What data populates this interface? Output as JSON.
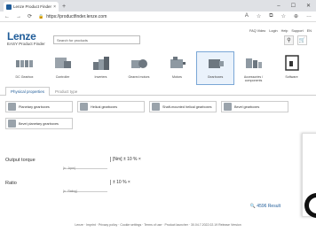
{
  "browser": {
    "tab_title": "Lenze Product Finder",
    "new_tab": "+",
    "window_controls": [
      "–",
      "☐",
      "✕"
    ],
    "url": "https://productfinder.lenze.com",
    "nav": [
      "←",
      "→",
      "⟳"
    ],
    "addr_icons": [
      "A",
      "☆",
      "⧉",
      "☆",
      "⊕",
      "…"
    ]
  },
  "header": {
    "logo": "Lenze",
    "subtitle": "EASY Product Finder",
    "search_placeholder": "Search for products",
    "top_links": [
      "FAQ Video",
      "Login",
      "Help",
      "Support",
      "EN"
    ]
  },
  "categories": [
    {
      "label": "DC Gearbox",
      "icon": "dc-gearbox-icon"
    },
    {
      "label": "Controller",
      "icon": "controller-icon"
    },
    {
      "label": "Inverters",
      "icon": "inverter-icon"
    },
    {
      "label": "Geared motors",
      "icon": "geared-motor-icon"
    },
    {
      "label": "Motors",
      "icon": "motor-icon"
    },
    {
      "label": "Gearboxes",
      "icon": "gearbox-icon",
      "active": true
    },
    {
      "label": "Accessories / components",
      "icon": "accessories-icon"
    },
    {
      "label": "Software",
      "icon": "software-icon"
    }
  ],
  "filter_tabs": [
    "Physical properties",
    "Product type"
  ],
  "gearbox_types": [
    "Planetary gearboxes",
    "Helical gearboxes",
    "Shaft-mounted helical gearboxes",
    "Bevel gearboxes",
    "Bevel planetary gearboxes"
  ],
  "filters": [
    {
      "label": "Output torque",
      "caption": "[n · 1rpm]",
      "value": "[Nm] ± 10 % ×"
    },
    {
      "label": "Ratio",
      "caption": "[n · Rating]",
      "value": "± 10 % ×"
    }
  ],
  "results": "🔍 4596 Result",
  "footer": "Lenze · Imprint · Privacy policy · Cookie settings · Terms of use · Product launcher · 30.04.7.2022.02.19 Release Version"
}
